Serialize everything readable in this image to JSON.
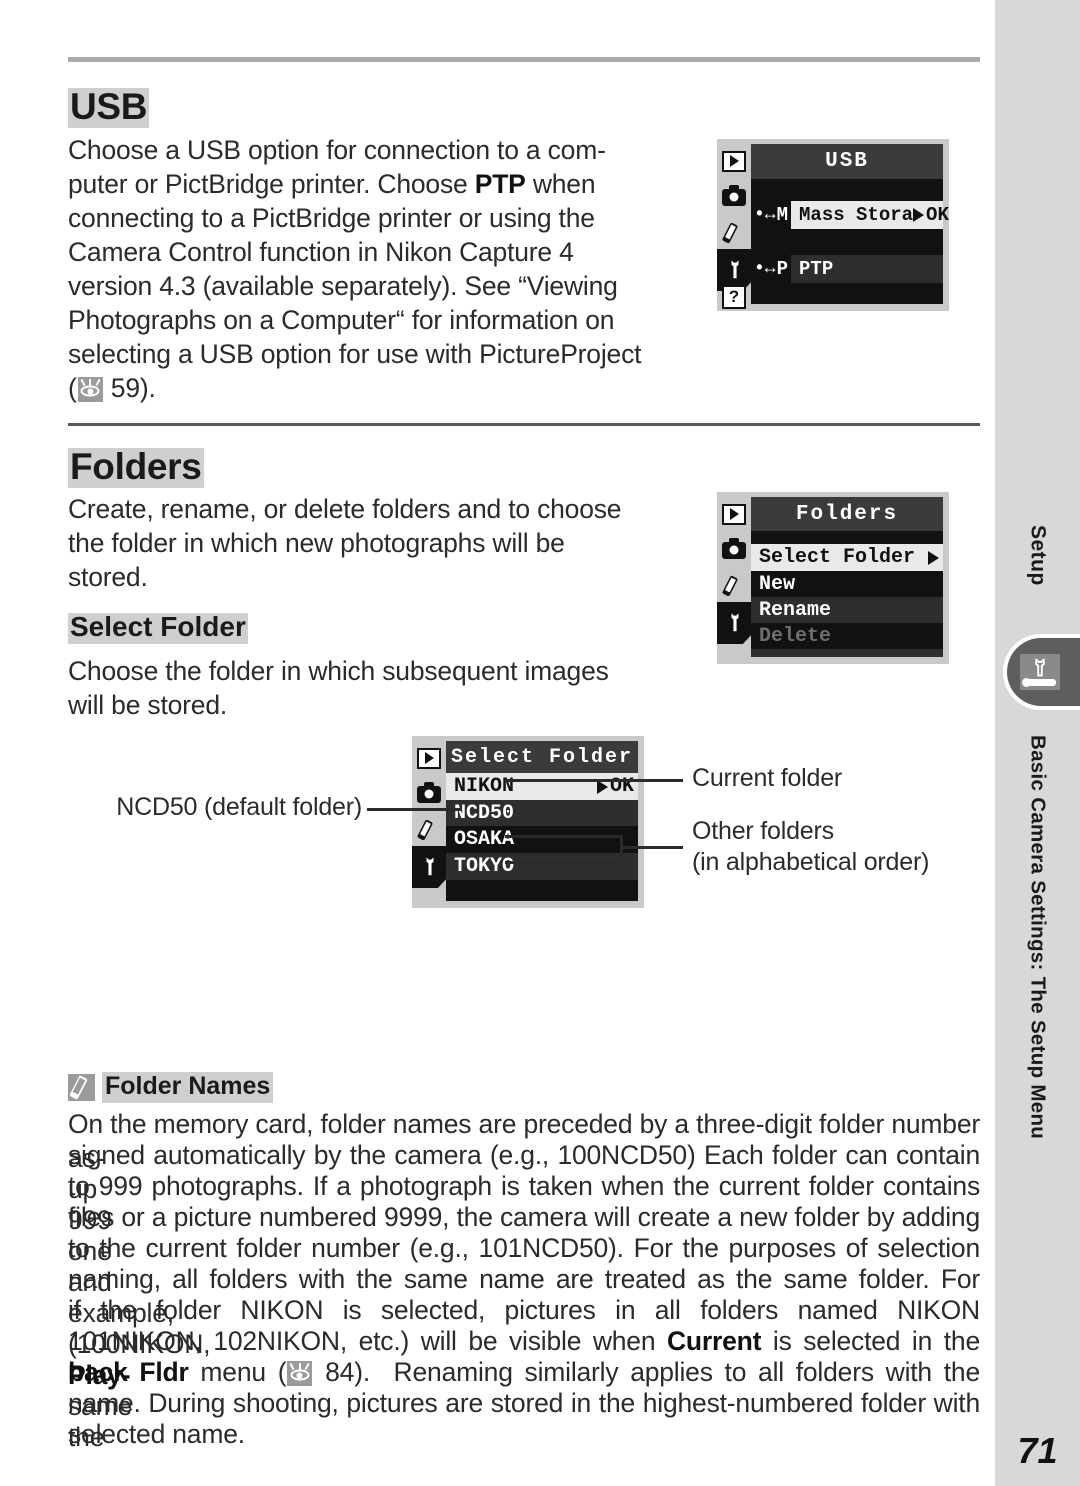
{
  "page": {
    "number": "71",
    "side_tab_label": "Setup",
    "side_running_head": "Basic Camera Settings: The Setup Menu",
    "tab_icon": "wrench-setup-icon"
  },
  "usb_section": {
    "heading": "USB",
    "body_lines": [
      "Choose a USB option for connection to a com-",
      "puter or PictBridge printer.  Choose PTP when",
      "connecting to a PictBridge printer or using the",
      "Camera Control function in Nikon Capture 4",
      "version 4.3 (available separately).  See “Viewing",
      "Photographs on a Computer“ for information on",
      "selecting a USB option for use with PictureProject",
      "59)."
    ],
    "bold_terms": [
      "PTP"
    ],
    "reference_page": "59",
    "screen": {
      "title": "USB",
      "items": [
        {
          "tag": "M",
          "label": "Mass Stora",
          "confirm": "OK",
          "selected": true
        },
        {
          "tag": "P",
          "label": "PTP",
          "confirm": "",
          "selected": false
        }
      ],
      "sidebar_icons": [
        "playback-icon",
        "camera-icon",
        "pencil-icon",
        "wrench-icon",
        "help-icon"
      ]
    }
  },
  "folders_section": {
    "heading": "Folders",
    "body_lines": [
      "Create, rename, or delete folders and to choose",
      "the folder in which new photographs will be",
      "stored."
    ],
    "screen": {
      "title": "Folders",
      "items": [
        {
          "label": "Select Folder",
          "selected": true,
          "arrow": true,
          "disabled": false
        },
        {
          "label": "New",
          "selected": false,
          "arrow": false,
          "disabled": false
        },
        {
          "label": "Rename",
          "selected": false,
          "arrow": false,
          "disabled": false
        },
        {
          "label": "Delete",
          "selected": false,
          "arrow": false,
          "disabled": true
        }
      ]
    }
  },
  "select_folder_section": {
    "heading": "Select Folder",
    "body_lines": [
      "Choose the folder in which subsequent images",
      "will be stored."
    ],
    "screen": {
      "title": "Select Folder",
      "items": [
        {
          "label": "NIKON",
          "selected": true,
          "confirm": "OK"
        },
        {
          "label": "NCD50",
          "selected": false,
          "confirm": ""
        },
        {
          "label": "OSAKA",
          "selected": false,
          "confirm": ""
        },
        {
          "label": "TOKYO",
          "selected": false,
          "confirm": ""
        }
      ]
    },
    "callouts": {
      "left": "NCD50 (default folder)",
      "right_top": "Current folder",
      "right_bottom_line1": "Other folders",
      "right_bottom_line2": "(in alphabetical order)"
    }
  },
  "note": {
    "icon": "pencil-note-icon",
    "title": "Folder Names",
    "lines": [
      "On the memory card, folder names are preceded by a three-digit folder number as-",
      "signed automatically by the camera (e.g., 100NCD50)  Each folder can contain up",
      "to 999 photographs.  If a photograph is taken when the current folder contains 999",
      "files or a picture numbered 9999, the camera will create a new folder by adding one",
      "to the current folder number (e.g., 101NCD50).  For the purposes of selection and",
      "naming, all folders with the same name are treated as the same folder.  For example,",
      "if the folder NIKON is selected, pictures in all folders named NIKON (100NIKON,",
      "101NIKON, 102NIKON, etc.) will be visible when Current is selected in the Play-",
      "back Fldr menu (  84).  Renaming similarly applies to all folders with the same",
      "name.  During shooting, pictures are stored in the highest-numbered folder with the",
      "selected name."
    ],
    "bold_terms": [
      "Current",
      "Playback Fldr"
    ],
    "reference_page": "84"
  }
}
